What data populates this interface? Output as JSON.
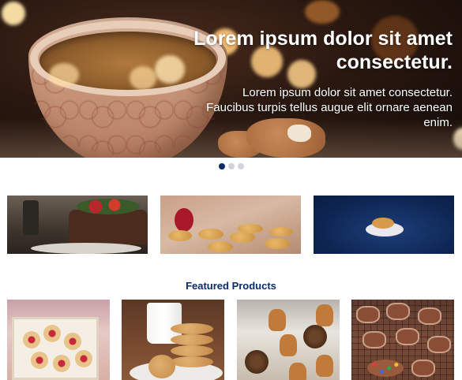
{
  "hero": {
    "title": "Lorem ipsum dolor sit amet consectetur.",
    "subtitle": "Lorem ipsum dolor sit amet consectetur. Faucibus turpis tellus augue elit ornare aenean enim."
  },
  "carousel": {
    "slides": 3,
    "active_index": 0,
    "colors": {
      "active": "#0d2a6b",
      "inactive": "#d0d3d8"
    }
  },
  "banners": [
    {
      "image": "christmas-cake-photo"
    },
    {
      "image": "cookies-on-baking-paper-photo"
    },
    {
      "image": "cookies-on-blue-background-photo"
    }
  ],
  "featured": {
    "title": "Featured Products",
    "title_color": "#0d2a6b",
    "products": [
      {
        "image": "cookie-gift-box-photo"
      },
      {
        "image": "chocolate-chip-cookies-milk-photo"
      },
      {
        "image": "gingerbread-men-photo"
      },
      {
        "image": "decorated-gingerbread-rack-photo"
      }
    ]
  }
}
